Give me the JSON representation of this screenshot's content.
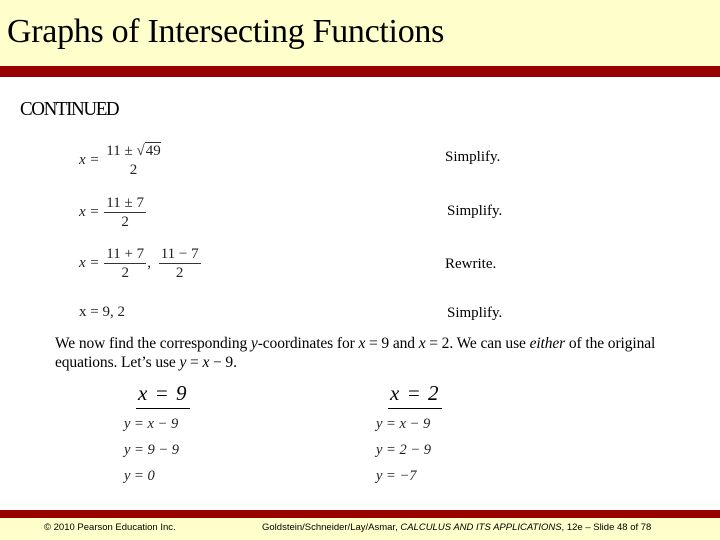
{
  "header": {
    "title": "Graphs of Intersecting Functions"
  },
  "section_label": "CONTINUED",
  "steps": [
    {
      "lhs": "x =",
      "num_a": "11 ± ",
      "num_sqrt": "49",
      "den": "2",
      "note": "Simplify."
    },
    {
      "lhs": "x =",
      "num": "11 ± 7",
      "den": "2",
      "note": "Simplify."
    },
    {
      "lhs": "x =",
      "num1": "11 + 7",
      "den1": "2",
      "sep": ",",
      "num2": "11 − 7",
      "den2": "2",
      "note": "Rewrite."
    },
    {
      "expr": "x = 9,  2",
      "note": "Simplify."
    }
  ],
  "paragraph": {
    "part1": "We now find the corresponding ",
    "y_var": "y",
    "part2": "-coordinates for ",
    "x1": "x",
    "part3": " = 9 and ",
    "x2": "x",
    "part4": " = 2.  We can use ",
    "either": "either",
    "part5": " of the original equations.  Let’s use ",
    "y_eq": "y",
    "part6": " = ",
    "x_eq": "x",
    "part7": " − 9."
  },
  "columns": [
    {
      "heading": "x = 9",
      "lines": [
        "y = x − 9",
        "y = 9 − 9",
        "y = 0"
      ]
    },
    {
      "heading": "x = 2",
      "lines": [
        "y = x − 9",
        "y = 2 − 9",
        "y = −7"
      ]
    }
  ],
  "footer": {
    "copyright": "© 2010 Pearson Education Inc.",
    "citation_prefix": "Goldstein/Schneider/Lay/Asmar, ",
    "citation_title": "CALCULUS AND ITS APPLICATIONS",
    "citation_suffix": ", 12e – Slide 48 of 78"
  },
  "colors": {
    "header_bg": "#ffffcc",
    "accent_bar": "#990000"
  }
}
